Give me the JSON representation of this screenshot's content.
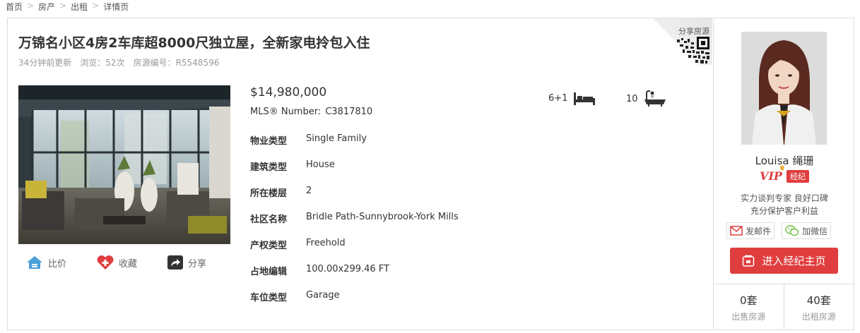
{
  "breadcrumb": {
    "items": [
      "首页",
      "房产",
      "出租",
      "详情页"
    ],
    "separator": ">"
  },
  "listing": {
    "title": "万锦名小区4房2车库超8000尺独立屋，全新家电拎包入住",
    "updated": "34分钟前更新",
    "views": "浏览：52次",
    "listing_id": "房源编号：R5548596",
    "share_label": "分享房源",
    "price": "$14,980,000",
    "mls_label": "MLS® Number:",
    "mls_value": "C3817810",
    "bedrooms": "6+1",
    "bathrooms": "10",
    "properties": [
      {
        "label": "物业类型",
        "value": "Single Family"
      },
      {
        "label": "建筑类型",
        "value": "House"
      },
      {
        "label": "所在楼层",
        "value": "2"
      },
      {
        "label": "社区名称",
        "value": "Bridle Path-Sunnybrook-York Mills"
      },
      {
        "label": "产权类型",
        "value": "Freehold"
      },
      {
        "label": "占地编辑",
        "value": "100.00x299.46 FT"
      },
      {
        "label": "车位类型",
        "value": "Garage"
      }
    ],
    "actions": {
      "compare": "比价",
      "favorite": "收藏",
      "share": "分享"
    }
  },
  "agent": {
    "name": "Louisa 绳珊",
    "vip_label": "VIP",
    "role": "经纪",
    "tags_line1": "实力谈判专家 良好口碑",
    "tags_line2": "充分保护客户利益",
    "email_label": "发邮件",
    "wechat_label": "加微信",
    "home_button": "进入经纪主页",
    "sale_count": "0套",
    "sale_label": "出售房源",
    "rent_count": "40套",
    "rent_label": "出租房源"
  },
  "colors": {
    "accent": "#e03e3e",
    "compare_icon": "#4a9fd8",
    "favorite_icon": "#e03e3e",
    "share_icon": "#333333",
    "wechat_icon": "#6cbf3e"
  },
  "icons": {
    "compare": "house-compare-icon",
    "favorite": "heart-plus-icon",
    "share": "share-arrow-icon",
    "bed": "bed-icon",
    "bath": "bathtub-icon",
    "email": "envelope-icon",
    "wechat": "wechat-icon",
    "home": "home-page-icon",
    "qr": "qr-code-icon"
  }
}
